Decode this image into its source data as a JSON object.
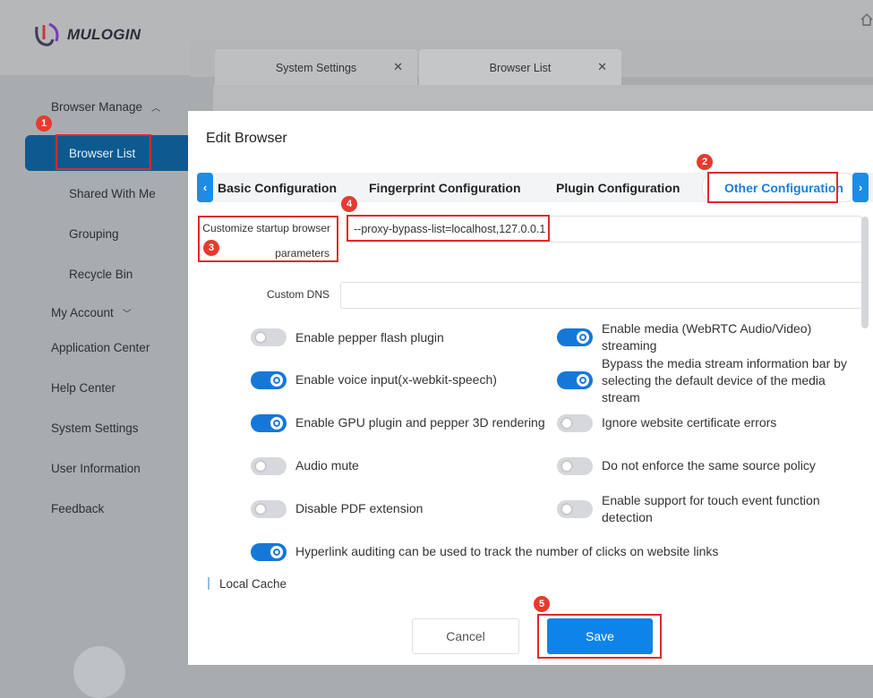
{
  "app": {
    "brand": "MULOGIN",
    "brand_color": "#2a2d3a"
  },
  "sidebar": {
    "items": [
      {
        "label": "Browser Manage"
      },
      {
        "label": "Browser List"
      },
      {
        "label": "Shared With Me"
      },
      {
        "label": "Grouping"
      },
      {
        "label": "Recycle Bin"
      },
      {
        "label": "My Account"
      },
      {
        "label": "Application Center"
      },
      {
        "label": "Help Center"
      },
      {
        "label": "System Settings"
      },
      {
        "label": "User Information"
      },
      {
        "label": "Feedback"
      }
    ]
  },
  "page_tabs": [
    {
      "label": "System Settings"
    },
    {
      "label": "Browser List"
    }
  ],
  "modal": {
    "title": "Edit Browser",
    "tabs": [
      {
        "label": "Basic Configuration"
      },
      {
        "label": "Fingerprint Configuration"
      },
      {
        "label": "Plugin Configuration"
      },
      {
        "label": "Other Configuration"
      }
    ],
    "active_tab": "Other Configuration",
    "startup_params": {
      "label_line1": "Customize startup browser",
      "label_line2": "parameters",
      "value": "--proxy-bypass-list=localhost,127.0.0.1"
    },
    "custom_dns": {
      "label": "Custom DNS",
      "value": ""
    },
    "options_left": [
      {
        "label": "Enable pepper flash plugin",
        "enabled": false
      },
      {
        "label": "Enable voice input(x-webkit-speech)",
        "enabled": true
      },
      {
        "label": "Enable GPU plugin and pepper 3D rendering",
        "enabled": true
      },
      {
        "label": "Audio mute",
        "enabled": false
      },
      {
        "label": "Disable PDF extension",
        "enabled": false
      }
    ],
    "options_right": [
      {
        "label": "Enable media (WebRTC Audio/Video) streaming",
        "enabled": true
      },
      {
        "label": "Bypass the media stream information bar by selecting the default device of the media stream",
        "enabled": true
      },
      {
        "label": "Ignore website certificate errors",
        "enabled": false
      },
      {
        "label": "Do not enforce the same source policy",
        "enabled": false
      },
      {
        "label": "Enable support for touch event function detection",
        "enabled": false
      }
    ],
    "option_full": {
      "label": "Hyperlink auditing can be used to track the number of clicks on website links",
      "enabled": true
    },
    "section_local_cache": "Local Cache",
    "cancel_label": "Cancel",
    "save_label": "Save"
  },
  "annotations": [
    "1",
    "2",
    "3",
    "4",
    "5"
  ],
  "colors": {
    "accent": "#1678d6",
    "annotation": "#e02a2a",
    "save": "#0e84ea"
  }
}
